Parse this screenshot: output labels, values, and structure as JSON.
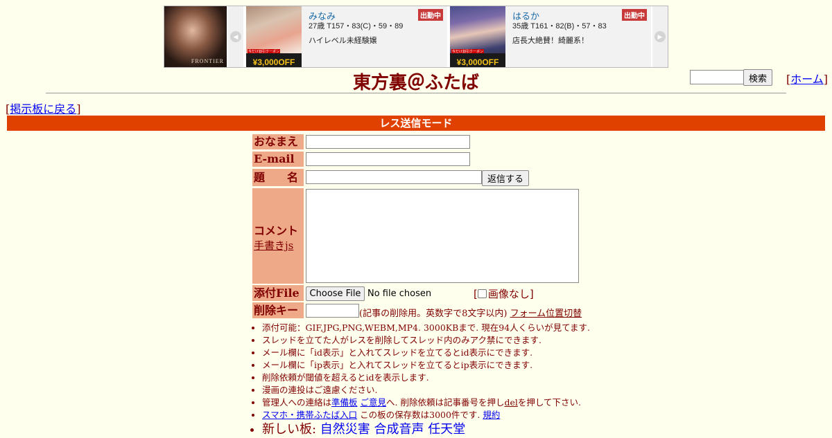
{
  "banner": {
    "logo_brand": "FRONTIER",
    "coupon_text": "¥3,000OFF",
    "coupon_tag": "今だけ割引クーポン",
    "cards": [
      {
        "name": "みなみ",
        "spec": "27歳 T157・83(C)・59・89",
        "desc": "ハイレベル未経験嬢",
        "badge": "出勤中"
      },
      {
        "name": "はるか",
        "spec": "35歳 T161・82(B)・57・83",
        "desc": "店長大絶賛！綺麗系！",
        "badge": "出勤中"
      }
    ]
  },
  "header": {
    "title": "東方裏＠ふたば",
    "search_button": "検索",
    "home_link": "ホーム",
    "back_link": "掲示板に戻る",
    "bracket_open": "[",
    "bracket_close": "]"
  },
  "mode_bar": "レス送信モード",
  "form": {
    "name_label": "おなまえ",
    "email_label": "E-mail",
    "subject_label": "題　　名",
    "submit_button": "返信する",
    "comment_label": "コメント",
    "handwrite_link": "手書きjs",
    "file_label": "添付File",
    "file_button": "Choose File",
    "file_status": "No file chosen",
    "noimg_label": "画像なし",
    "delkey_label": "削除キー",
    "delkey_note": "(記事の削除用。英数字で8文字以内)",
    "form_toggle_link": "フォーム位置切替"
  },
  "notes": {
    "n1": "添付可能：GIF,JPG,PNG,WEBM,MP4. 3000KBまで. 現在94人くらいが見てます.",
    "n2": "スレッドを立てた人がレスを削除してスレッド内のみアク禁にできます.",
    "n3": "メール欄に「id表示」と入れてスレッドを立てるとid表示にできます.",
    "n4": "メール欄に「ip表示」と入れてスレッドを立てるとip表示にできます.",
    "n5": "削除依頼が閾値を超えるとidを表示します.",
    "n6": "漫画の連投はご遠慮ください.",
    "n7_pre": "管理人への連絡は",
    "n7_link1": "準備板",
    "n7_link2": "ご意見",
    "n7_mid": "へ. 削除依頼は記事番号を押し",
    "n7_link3": "del",
    "n7_post": "を押して下さい.",
    "n8_link": "スマホ・携帯ふたば入口",
    "n8_text": " この板の保存数は3000件です. ",
    "n8_link2": "規約",
    "n9_label": "新しい板: ",
    "n9_boards": [
      "自然災害",
      "合成音声",
      "任天堂"
    ]
  }
}
